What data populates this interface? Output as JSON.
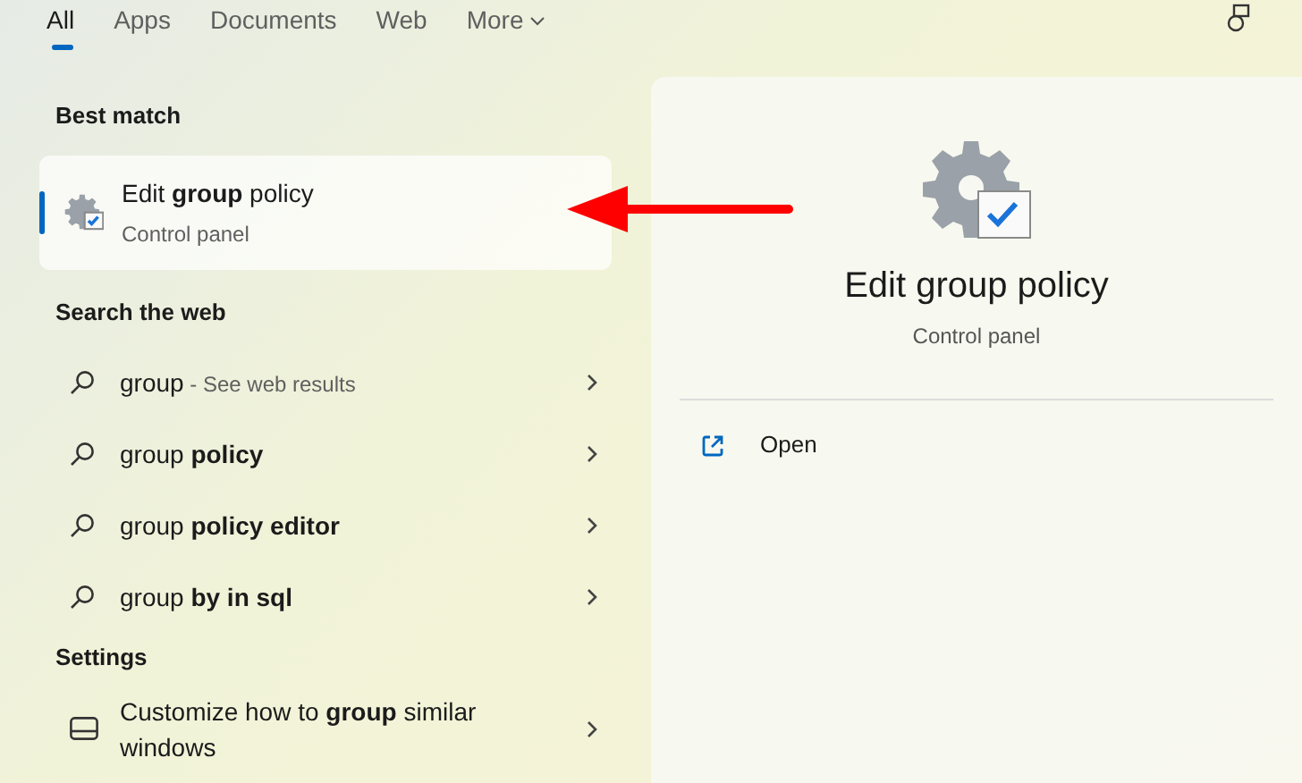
{
  "tabs": [
    {
      "label": "All",
      "selected": true
    },
    {
      "label": "Apps",
      "selected": false
    },
    {
      "label": "Documents",
      "selected": false
    },
    {
      "label": "Web",
      "selected": false
    },
    {
      "label": "More",
      "selected": false,
      "dropdown": true
    }
  ],
  "best_match": {
    "heading": "Best match",
    "title": "Edit **group** policy",
    "subtitle": "Control panel",
    "selected": true
  },
  "web": {
    "heading": "Search the web",
    "items": [
      {
        "text": "group",
        "suffix": " - See web results"
      },
      {
        "text": "group **policy**"
      },
      {
        "text": "group **policy editor**"
      },
      {
        "text": "group **by in sql**"
      }
    ]
  },
  "settings": {
    "heading": "Settings",
    "items": [
      {
        "text": "Customize how to **group** similar windows"
      }
    ]
  },
  "detail": {
    "title": "Edit group policy",
    "subtitle": "Control panel",
    "actions": [
      {
        "label": "Open"
      }
    ]
  }
}
